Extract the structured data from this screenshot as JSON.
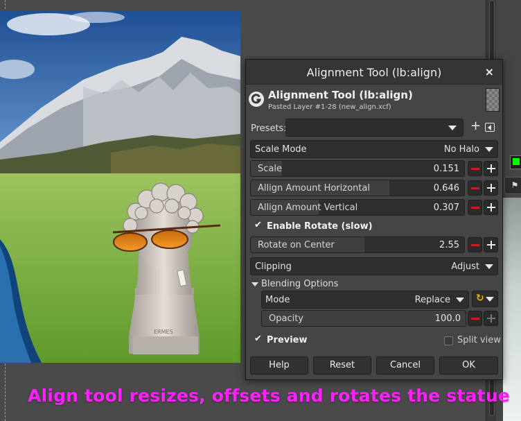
{
  "dialog": {
    "title": "Alignment Tool (lb:align)",
    "close_glyph": "×",
    "tool_title": "Alignment Tool (lb:align)",
    "subtitle": "Pasted Layer #1-28 (new_align.xcf)",
    "presets_label": "Presets:",
    "presets_value": "",
    "presets_add_glyph": "+",
    "scale_mode": {
      "label": "Scale Mode",
      "value": "No Halo"
    },
    "scale": {
      "label": "Scale",
      "value": "0.151",
      "fill_fraction": 0.151
    },
    "align_h": {
      "label": "Allign Amount Horizontal",
      "value": "0.646",
      "fill_fraction": 0.646
    },
    "align_v": {
      "label": "Allign Amount Vertical",
      "value": "0.307",
      "fill_fraction": 0.307
    },
    "enable_rotate": {
      "label": "Enable Rotate (slow)",
      "checked": true
    },
    "rotate_center": {
      "label": "Rotate on Center",
      "value": "2.55",
      "fill_fraction": 0.52
    },
    "clipping": {
      "label": "Clipping",
      "value": "Adjust"
    },
    "blending": {
      "label": "Blending Options",
      "expanded": true
    },
    "mode": {
      "label": "Mode",
      "value": "Replace"
    },
    "opacity": {
      "label": "Opacity",
      "value": "100.0",
      "fill_fraction": 1.0
    },
    "preview": {
      "label": "Preview",
      "checked": true
    },
    "split_view": {
      "label": "Split view",
      "checked": false
    },
    "buttons": {
      "help": "Help",
      "reset": "Reset",
      "cancel": "Cancel",
      "ok": "OK"
    }
  },
  "caption": "Align tool resizes, offsets and rotates the statue",
  "colors": {
    "caption": "#ff1fff",
    "foreground_swatch": "#00ff00",
    "guide": "#35c4d6",
    "minus_icon": "#d11c1c",
    "reset_icon": "#f5b100"
  },
  "icons": [
    "gimp-logo-icon",
    "close-icon",
    "chevron-down-icon",
    "plus-icon",
    "minus-icon",
    "menu-arrow-icon",
    "check-icon",
    "reset-icon"
  ]
}
